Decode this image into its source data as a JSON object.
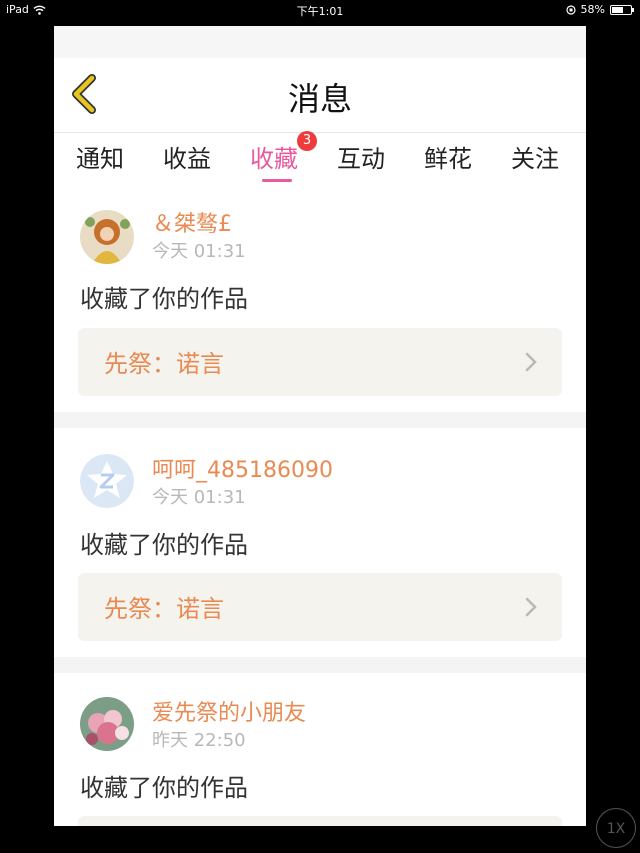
{
  "status_bar": {
    "device": "iPad",
    "time": "下午1:01",
    "battery": "58%"
  },
  "header": {
    "title": "消息"
  },
  "tabs": [
    {
      "label": "通知"
    },
    {
      "label": "收益"
    },
    {
      "label": "收藏",
      "badge": "3",
      "active": true
    },
    {
      "label": "互动"
    },
    {
      "label": "鲜花"
    },
    {
      "label": "关注"
    }
  ],
  "messages": [
    {
      "user": "＆桀骜£",
      "time": "今天 01:31",
      "action": "收藏了你的作品",
      "work": "先祭：诺言"
    },
    {
      "user": "呵呵_485186090",
      "time": "今天 01:31",
      "action": "收藏了你的作品",
      "work": "先祭：诺言"
    },
    {
      "user": "爱先祭的小朋友",
      "time": "昨天 22:50",
      "action": "收藏了你的作品"
    }
  ],
  "zoom_button": {
    "label": "1X"
  },
  "colors": {
    "accent": "#e85aa0",
    "username": "#e98a52",
    "badge": "#ef3b3b",
    "back_arrow": "#e8c51f"
  }
}
